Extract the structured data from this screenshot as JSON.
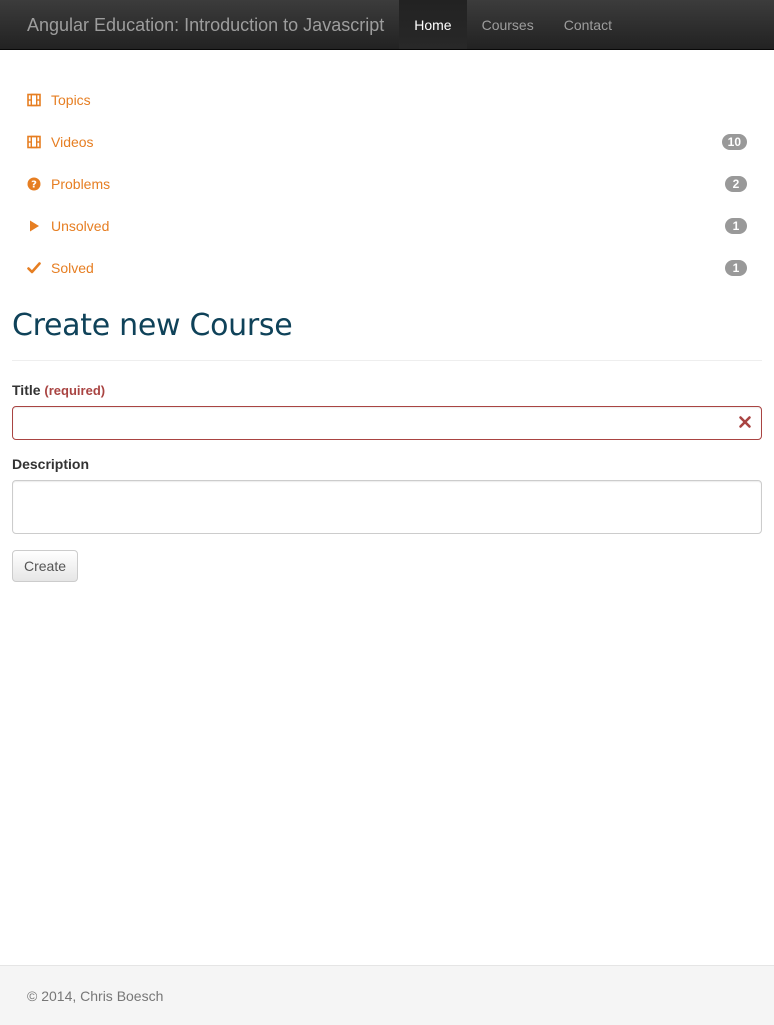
{
  "navbar": {
    "brand": "Angular Education: Introduction to Javascript",
    "items": [
      {
        "label": "Home",
        "active": true
      },
      {
        "label": "Courses",
        "active": false
      },
      {
        "label": "Contact",
        "active": false
      }
    ]
  },
  "sidebar": {
    "items": [
      {
        "icon": "film-icon",
        "label": "Topics",
        "badge": ""
      },
      {
        "icon": "film-icon",
        "label": "Videos",
        "badge": "10"
      },
      {
        "icon": "question-circle-icon",
        "label": "Problems",
        "badge": "2"
      },
      {
        "icon": "play-icon",
        "label": "Unsolved",
        "badge": "1"
      },
      {
        "icon": "check-icon",
        "label": "Solved",
        "badge": "1"
      }
    ]
  },
  "form": {
    "heading": "Create new Course",
    "title_label": "Title",
    "title_required": "(required)",
    "title_value": "",
    "description_label": "Description",
    "description_value": "",
    "submit_label": "Create"
  },
  "footer": {
    "text": "© 2014, Chris Boesch"
  },
  "colors": {
    "accent": "#e67e22",
    "heading": "#0f4259",
    "error": "#a94442",
    "badge": "#999999"
  }
}
